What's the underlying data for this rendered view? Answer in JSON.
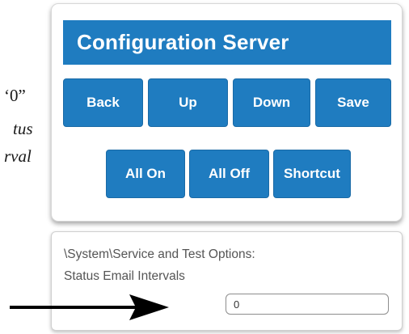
{
  "doc_text": {
    "zero_value": "‘0”",
    "status_fragment": "tus",
    "interval_fragment": "rval"
  },
  "config_panel": {
    "title": "Configuration Server",
    "nav_buttons": {
      "back": "Back",
      "up": "Up",
      "down": "Down",
      "save": "Save"
    },
    "bulk_buttons": {
      "all_on": "All On",
      "all_off": "All Off",
      "shortcut": "Shortcut"
    }
  },
  "options_panel": {
    "path": "\\System\\Service and Test Options:",
    "setting_label": "Status Email Intervals",
    "input_value": "0"
  },
  "colors": {
    "button_blue": "#1f7cc0",
    "text_gray": "#555555"
  },
  "annotation": {
    "arrow_icon": "right-arrow-icon"
  }
}
